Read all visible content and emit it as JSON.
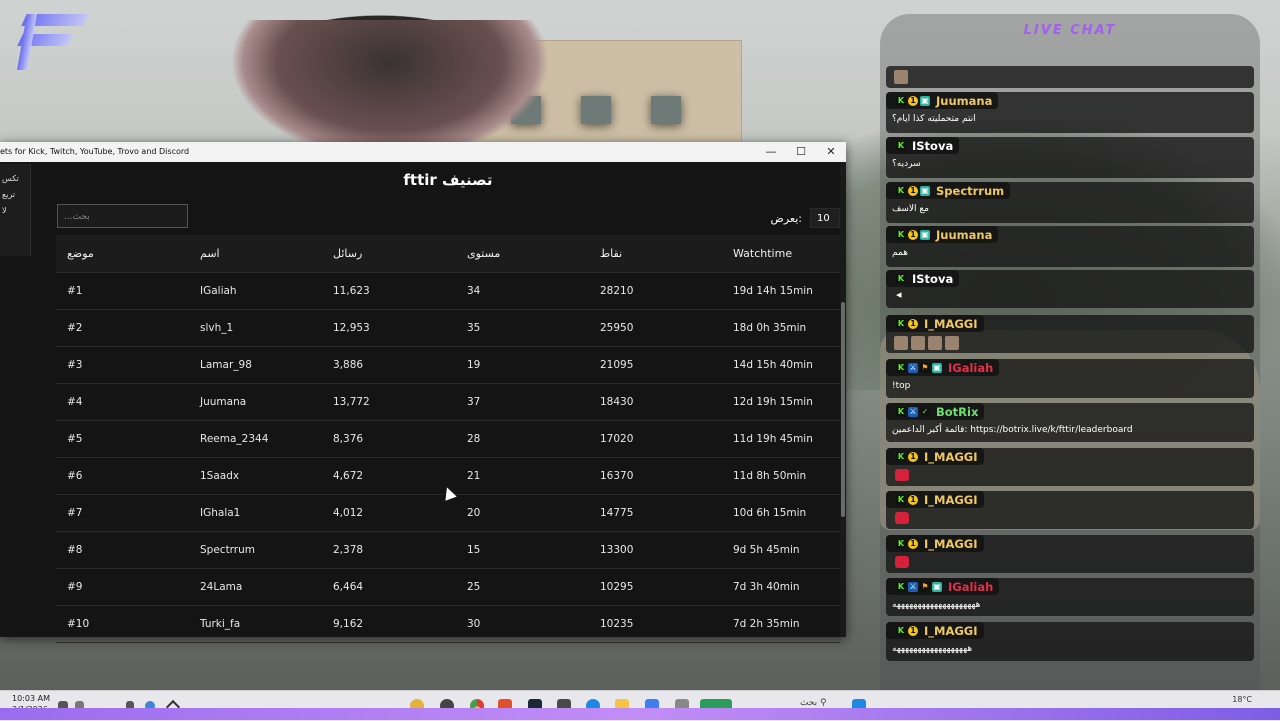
{
  "window": {
    "title": "ets for Kick, Twitch, YouTube, Trovo and Discord",
    "controls": {
      "minimize": "—",
      "maximize": "☐",
      "close": "✕"
    }
  },
  "side_panel": {
    "lines": [
      "تكس",
      "تريع",
      "لا"
    ]
  },
  "leaderboard": {
    "heading": "fttir تصنيف",
    "search_placeholder": "بحث...",
    "show_label": "يعرض:",
    "show_value": "10",
    "columns": [
      "موضع",
      "اسم",
      "رسائل",
      "مستوى",
      "نقاط",
      "Watchtime"
    ],
    "rows": [
      [
        "#1",
        "IGaliah",
        "11,623",
        "34",
        "28210",
        "19d 14h 15min"
      ],
      [
        "#2",
        "slvh_1",
        "12,953",
        "35",
        "25950",
        "18d 0h 35min"
      ],
      [
        "#3",
        "Lamar_98",
        "3,886",
        "19",
        "21095",
        "14d 15h 40min"
      ],
      [
        "#4",
        "Juumana",
        "13,772",
        "37",
        "18430",
        "12d 19h 15min"
      ],
      [
        "#5",
        "Reema_2344",
        "8,376",
        "28",
        "17020",
        "11d 19h 45min"
      ],
      [
        "#6",
        "1Saadx",
        "4,672",
        "21",
        "16370",
        "11d 8h 50min"
      ],
      [
        "#7",
        "IGhala1",
        "4,012",
        "20",
        "14775",
        "10d 6h 15min"
      ],
      [
        "#8",
        "Spectrrum",
        "2,378",
        "15",
        "13300",
        "9d 5h 45min"
      ],
      [
        "#9",
        "24Lama",
        "6,464",
        "25",
        "10295",
        "7d 3h 40min"
      ],
      [
        "#10",
        "Turki_fa",
        "9,162",
        "30",
        "10235",
        "7d 2h 35min"
      ]
    ]
  },
  "chat": {
    "title": "LIVE CHAT",
    "messages": [
      {
        "user": "",
        "text": "",
        "color": "#ffffff"
      },
      {
        "user": "Juumana",
        "text": "انتم متحمليته كذا ايام؟",
        "color": "#f0c860"
      },
      {
        "user": "IStova",
        "text": "سرديه؟",
        "color": "#ffffff"
      },
      {
        "user": "Spectrrum",
        "text": "مع الاسف",
        "color": "#f0c860"
      },
      {
        "user": "Juumana",
        "text": "همم",
        "color": "#f0c860"
      },
      {
        "user": "IStova",
        "text": "",
        "color": "#ffffff"
      },
      {
        "user": "I_MAGGI",
        "text": "",
        "color": "#f0c860"
      },
      {
        "user": "IGaliah",
        "text": "!top",
        "color": "#e0304a"
      },
      {
        "user": "BotRix",
        "text": "قائمة أكبر الداعمين: https://botrix.live/k/fttir/leaderboard",
        "color": "#6fe06f"
      },
      {
        "user": "I_MAGGI",
        "text": "",
        "color": "#f0c860"
      },
      {
        "user": "I_MAGGI",
        "text": "",
        "color": "#f0c860"
      },
      {
        "user": "I_MAGGI",
        "text": "",
        "color": "#f0c860"
      },
      {
        "user": "IGaliah",
        "text": "ههههههههههههههههههههه",
        "color": "#e0304a"
      },
      {
        "user": "I_MAGGI",
        "text": "ههههههههههههههههههه",
        "color": "#f0c860"
      }
    ]
  },
  "taskbar": {
    "time": "10:03 AM",
    "date": "2/1/2026",
    "search_label": "بحث",
    "temperature": "18°C"
  }
}
